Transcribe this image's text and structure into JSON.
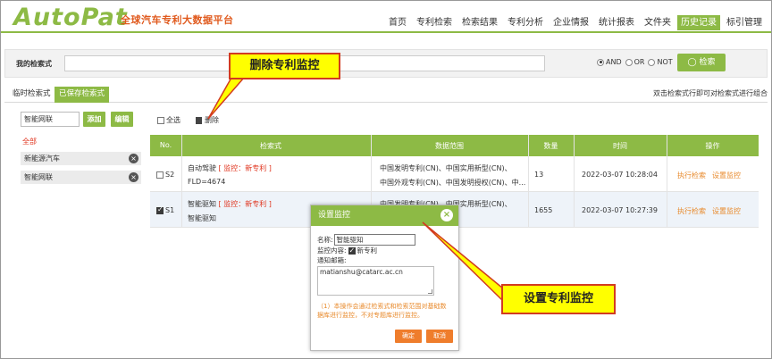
{
  "header": {
    "logo": "AutoPat",
    "logo_subtitle": "全球汽车专利大数据平台",
    "nav": [
      {
        "label": "首页",
        "active": false
      },
      {
        "label": "专利检索",
        "active": false
      },
      {
        "label": "检索结果",
        "active": false
      },
      {
        "label": "专利分析",
        "active": false
      },
      {
        "label": "企业情报",
        "active": false
      },
      {
        "label": "统计报表",
        "active": false
      },
      {
        "label": "文件夹",
        "active": false
      },
      {
        "label": "历史记录",
        "active": true
      },
      {
        "label": "标引管理",
        "active": false
      }
    ]
  },
  "search": {
    "label": "我的检索式",
    "value": "",
    "logic_options": [
      "AND",
      "OR",
      "NOT"
    ],
    "logic_selected": "AND",
    "button": "检索"
  },
  "tabs": {
    "items": [
      "临时检索式",
      "已保存检索式"
    ],
    "active": "已保存检索式",
    "hint": "双击检索式行即可对检索式进行组合"
  },
  "groups": {
    "input_value": "智能网联",
    "add_button": "添加",
    "edit_button": "编辑",
    "all_label": "全部",
    "items": [
      "新能源汽车",
      "智能网联"
    ]
  },
  "toolbar": {
    "select_all": "全选",
    "delete": "删除"
  },
  "table": {
    "columns": [
      "No.",
      "检索式",
      "数据范围",
      "数量",
      "时间",
      "操作"
    ],
    "rows": [
      {
        "no": "S2",
        "checked": false,
        "name": "自动驾驶",
        "monitor_tag": "[ 监控：新专利 ]",
        "expr": "FLD=4674",
        "scope_line1": "中国发明专利(CN)、中国实用新型(CN)、",
        "scope_line2": "中国外观专利(CN)、中国发明授权(CN)、中...",
        "count": "13",
        "time": "2022-03-07 10:28:04",
        "op1": "执行检索",
        "op2": "设置监控"
      },
      {
        "no": "S1",
        "checked": true,
        "name": "智能驱知",
        "monitor_tag": "[ 监控：新专利 ]",
        "expr": "智能驱知",
        "scope_line1": "中国发明专利(CN)、中国实用新型(CN)、",
        "scope_line2": "",
        "count": "1655",
        "time": "2022-03-07 10:27:39",
        "op1": "执行检索",
        "op2": "设置监控"
      }
    ]
  },
  "dialog": {
    "title": "设置监控",
    "name_label": "名称:",
    "name_value": "智能驱知",
    "monitor_label": "监控内容:",
    "monitor_option": "新专利",
    "monitor_checked": true,
    "email_label": "通知邮箱:",
    "email_value": "matianshu@catarc.ac.cn",
    "note": "（1）本操作会通过检索式和检索范围对基础数据库进行监控，不对专题库进行监控。",
    "ok": "确定",
    "cancel": "取消"
  },
  "callouts": {
    "delete_monitor": "删除专利监控",
    "set_monitor": "设置专利监控"
  },
  "colors": {
    "accent": "#8dba45",
    "orange": "#ef7d2c",
    "red": "#e0341e",
    "callout_fill": "#ffff00"
  }
}
